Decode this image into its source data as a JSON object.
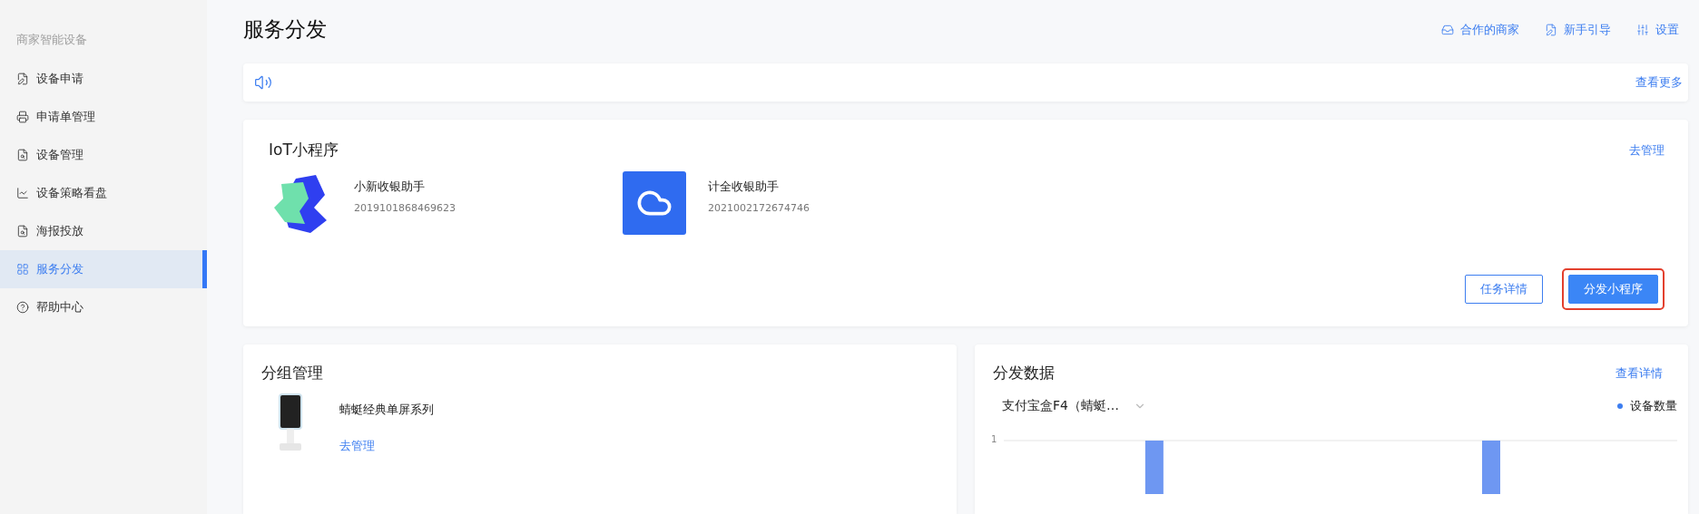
{
  "sidebar": {
    "heading": "商家智能设备",
    "items": [
      {
        "label": "设备申请",
        "selected": false
      },
      {
        "label": "申请单管理",
        "selected": false
      },
      {
        "label": "设备管理",
        "selected": false
      },
      {
        "label": "设备策略看盘",
        "selected": false
      },
      {
        "label": "海报投放",
        "selected": false
      },
      {
        "label": "服务分发",
        "selected": true
      },
      {
        "label": "帮助中心",
        "selected": false
      }
    ]
  },
  "page_title": "服务分发",
  "header_links": [
    {
      "label": "合作的商家"
    },
    {
      "label": "新手引导"
    },
    {
      "label": "设置"
    }
  ],
  "notice": {
    "more_link": "查看更多"
  },
  "iot": {
    "title": "IoT小程序",
    "manage_link": "去管理",
    "apps": [
      {
        "name": "小新收银助手",
        "id": "2019101868469623"
      },
      {
        "name": "计全收银助手",
        "id": "2021002172674746"
      }
    ],
    "buttons": [
      {
        "label": "任务详情",
        "kind": "outline",
        "highlighted": false
      },
      {
        "label": "分发小程序",
        "kind": "primary",
        "highlighted": true
      }
    ]
  },
  "groups": {
    "title": "分组管理",
    "items": [
      {
        "name": "蜻蜓经典单屏系列",
        "link": "去管理"
      }
    ]
  },
  "distribution": {
    "title": "分发数据",
    "detail_link": "查看详情",
    "dropdown": {
      "value": "支付宝盒F4（蜻蜓…"
    },
    "legend": "设备数量",
    "y_tick": "1"
  }
}
